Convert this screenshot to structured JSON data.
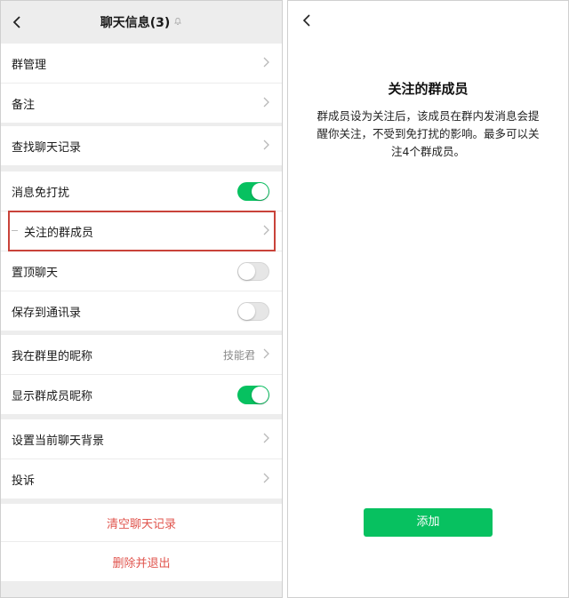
{
  "left_screen": {
    "title": "聊天信息(3)",
    "rows": {
      "group_manage": "群管理",
      "remark": "备注",
      "search_history": "查找聊天记录",
      "mute": "消息免打扰",
      "followed_members": "关注的群成员",
      "pin_chat": "置顶聊天",
      "save_contacts": "保存到通讯录",
      "my_nickname": "我在群里的昵称",
      "my_nickname_value": "技能君",
      "show_nicknames": "显示群成员昵称",
      "set_background": "设置当前聊天背景",
      "complain": "投诉"
    },
    "toggles": {
      "mute": "on",
      "pin_chat": "off",
      "save_contacts": "off",
      "show_nicknames": "on"
    },
    "actions": {
      "clear_history": "清空聊天记录",
      "delete_and_exit": "删除并退出"
    }
  },
  "right_screen": {
    "title": "关注的群成员",
    "description": "群成员设为关注后，该成员在群内发消息会提醒你关注，不受到免打扰的影响。最多可以关注4个群成员。",
    "add_button": "添加"
  },
  "colors": {
    "accent_green": "#07c160",
    "danger_red": "#e0544d",
    "highlight_border": "#c9433a",
    "page_gray": "#ededed"
  },
  "icons": [
    "back-chevron-icon",
    "bell-off-icon",
    "chevron-right-icon"
  ]
}
